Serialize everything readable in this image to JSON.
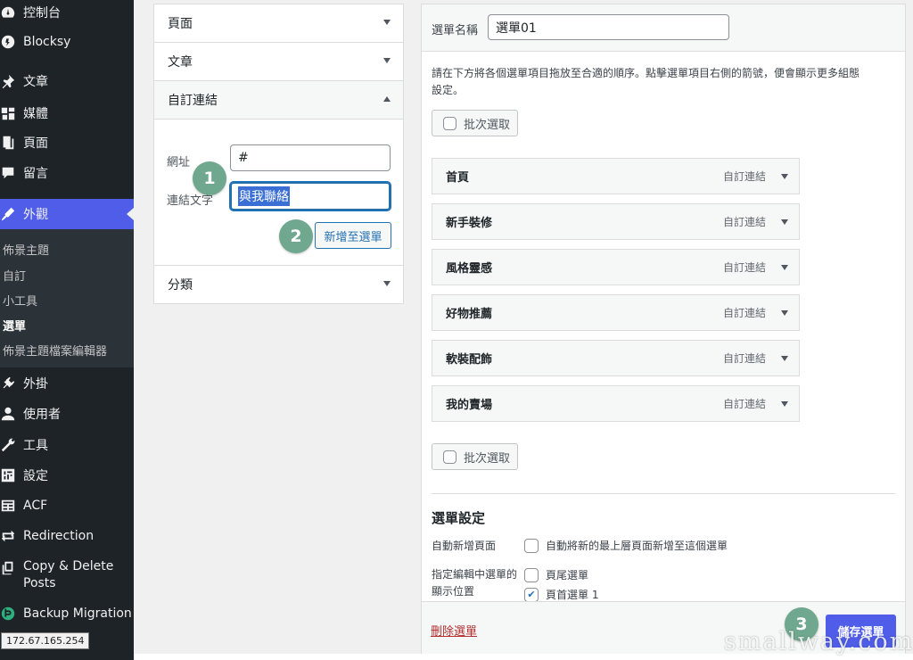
{
  "sidebar": {
    "items": [
      {
        "label": "控制台",
        "icon": "dashboard-icon"
      },
      {
        "label": "Blocksy",
        "icon": "blocksy-icon"
      },
      {
        "label": "文章",
        "icon": "pin-icon"
      },
      {
        "label": "媒體",
        "icon": "media-icon"
      },
      {
        "label": "頁面",
        "icon": "pages-icon"
      },
      {
        "label": "留言",
        "icon": "comment-icon"
      },
      {
        "label": "外觀",
        "icon": "appearance-icon"
      },
      {
        "label": "外掛",
        "icon": "plugin-icon"
      },
      {
        "label": "使用者",
        "icon": "user-icon"
      },
      {
        "label": "工具",
        "icon": "wrench-icon"
      },
      {
        "label": "設定",
        "icon": "settings-icon"
      },
      {
        "label": "ACF",
        "icon": "acf-icon"
      },
      {
        "label": "Redirection",
        "icon": "redirection-icon"
      },
      {
        "label": "Copy & Delete",
        "label2": "Posts",
        "icon": "copy-icon"
      },
      {
        "label": "Backup Migration",
        "icon": "backup-icon"
      }
    ],
    "submenu": [
      "佈景主題",
      "自訂",
      "小工具",
      "選單",
      "佈景主題檔案編輯器"
    ],
    "accent_color": "#4f5de8"
  },
  "tooltip": {
    "ip": "172.67.165.254"
  },
  "left_panel": {
    "sections": [
      {
        "title": "頁面"
      },
      {
        "title": "文章"
      },
      {
        "title": "自訂連結"
      },
      {
        "title": "分類"
      }
    ],
    "url_label": "網址",
    "url_value": "#",
    "link_text_label": "連結文字",
    "link_text_value": "與我聯絡",
    "add_button": "新增至選單"
  },
  "badges": [
    "1",
    "2",
    "3"
  ],
  "right_panel": {
    "menu_name_label": "選單名稱",
    "menu_name_value": "選單01",
    "instructions": [
      "請在下方將各個選單項目拖放至合適的順序。點擊選單項目右側的箭號，便會顯示更多組態",
      "設定。"
    ],
    "bulk_select": "批次選取",
    "items": [
      {
        "name": "首頁",
        "type": "自訂連結"
      },
      {
        "name": "新手裝修",
        "type": "自訂連結"
      },
      {
        "name": "風格靈感",
        "type": "自訂連結"
      },
      {
        "name": "好物推薦",
        "type": "自訂連結"
      },
      {
        "name": "軟裝配飾",
        "type": "自訂連結"
      },
      {
        "name": "我的賣場",
        "type": "自訂連結"
      }
    ],
    "settings_title": "選單設定",
    "auto_add_label": "自動新增頁面",
    "auto_add_option": "自動將新的最上層頁面新增至這個選單",
    "location_label_1": "指定編輯中選單的",
    "location_label_2": "顯示位置",
    "location_footer": "頁尾選單",
    "location_header": "頁首選單 1",
    "location_header_checked": true,
    "delete_link": "刪除選單",
    "save_button": "儲存選單"
  },
  "watermark": "smallway.com.tw"
}
